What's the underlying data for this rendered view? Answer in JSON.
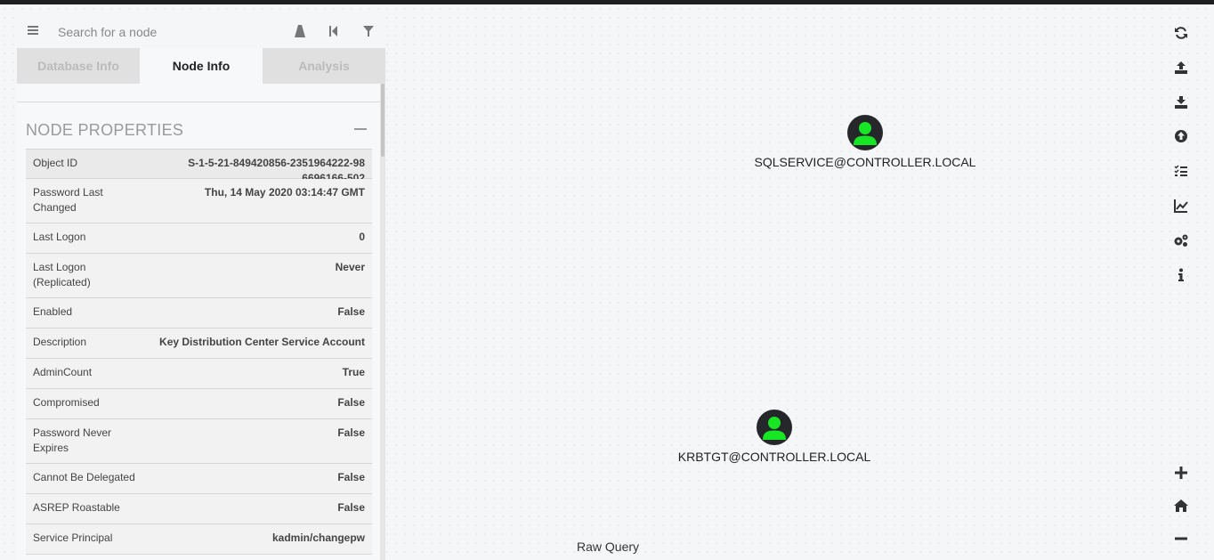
{
  "search": {
    "placeholder": "Search for a node"
  },
  "tabs": [
    {
      "label": "Database Info"
    },
    {
      "label": "Node Info"
    },
    {
      "label": "Analysis"
    }
  ],
  "section": {
    "title": "NODE PROPERTIES"
  },
  "properties": [
    {
      "key": "Object ID",
      "value": "S-1-5-21-849420856-2351964222-986696166-502"
    },
    {
      "key": "Password Last Changed",
      "value": "Thu, 14 May 2020 03:14:47 GMT"
    },
    {
      "key": "Last Logon",
      "value": "0"
    },
    {
      "key": "Last Logon (Replicated)",
      "value": "Never"
    },
    {
      "key": "Enabled",
      "value": "False"
    },
    {
      "key": "Description",
      "value": "Key Distribution Center Service Account"
    },
    {
      "key": "AdminCount",
      "value": "True"
    },
    {
      "key": "Compromised",
      "value": "False"
    },
    {
      "key": "Password Never Expires",
      "value": "False"
    },
    {
      "key": "Cannot Be Delegated",
      "value": "False"
    },
    {
      "key": "ASREP Roastable",
      "value": "False"
    },
    {
      "key": "Service Principal",
      "value": "kadmin/changepw"
    }
  ],
  "nodes": [
    {
      "label": "SQLSERVICE@CONTROLLER.LOCAL",
      "icon": "user-icon"
    },
    {
      "label": "KRBTGT@CONTROLLER.LOCAL",
      "icon": "user-icon"
    }
  ],
  "raw_query": {
    "label": "Raw Query"
  },
  "colors": {
    "user_green": "#17e625",
    "node_bg": "#26272b"
  }
}
